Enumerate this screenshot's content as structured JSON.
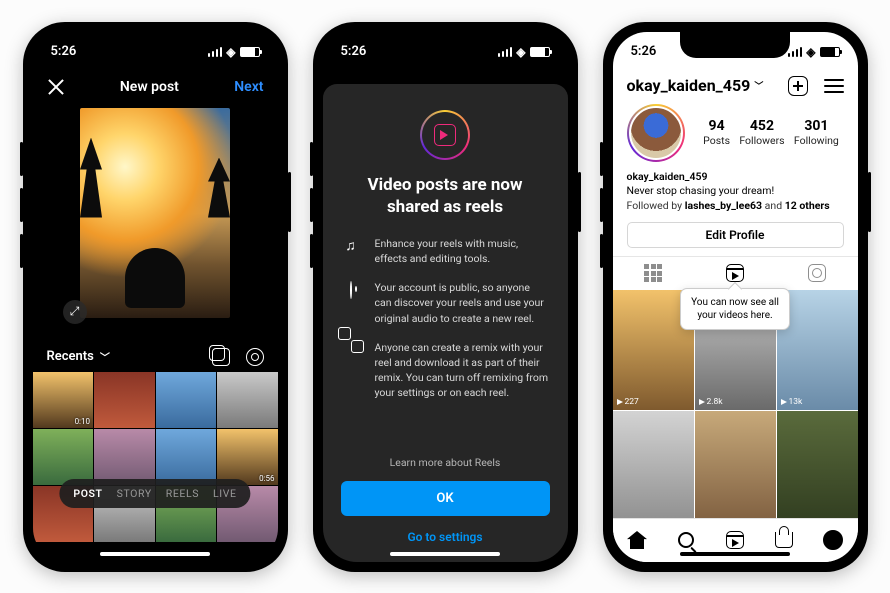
{
  "status": {
    "time": "5:26"
  },
  "phone1": {
    "title": "New post",
    "next": "Next",
    "album": "Recents",
    "durations": {
      "d1": "0:10",
      "d2": "0:56"
    },
    "modes": {
      "post": "POST",
      "story": "STORY",
      "reels": "REELS",
      "live": "LIVE"
    }
  },
  "phone2": {
    "title": "Video posts are now shared as reels",
    "feat1": "Enhance your reels with music, effects and editing tools.",
    "feat2": "Your account is public, so anyone can discover your reels and use your original audio to create a new reel.",
    "feat3": "Anyone can create a remix with your reel and download it as part of their remix. You can turn off remixing from your settings or on each reel.",
    "learn": "Learn more about Reels",
    "ok": "OK",
    "settings": "Go to settings"
  },
  "phone3": {
    "username": "okay_kaiden_459",
    "stats": {
      "posts_n": "94",
      "posts_l": "Posts",
      "foll_n": "452",
      "foll_l": "Followers",
      "fing_n": "301",
      "fing_l": "Following"
    },
    "bio": {
      "username": "okay_kaiden_459",
      "tagline": "Never stop chasing your dream!",
      "followed_prefix": "Followed by ",
      "followed_name": "lashes_by_lee63",
      "followed_and": " and ",
      "followed_others": "12 others"
    },
    "edit": "Edit Profile",
    "tooltip": "You can now see all your videos here.",
    "views": {
      "v1": "227",
      "v2": "2.8k",
      "v3": "13k"
    }
  }
}
